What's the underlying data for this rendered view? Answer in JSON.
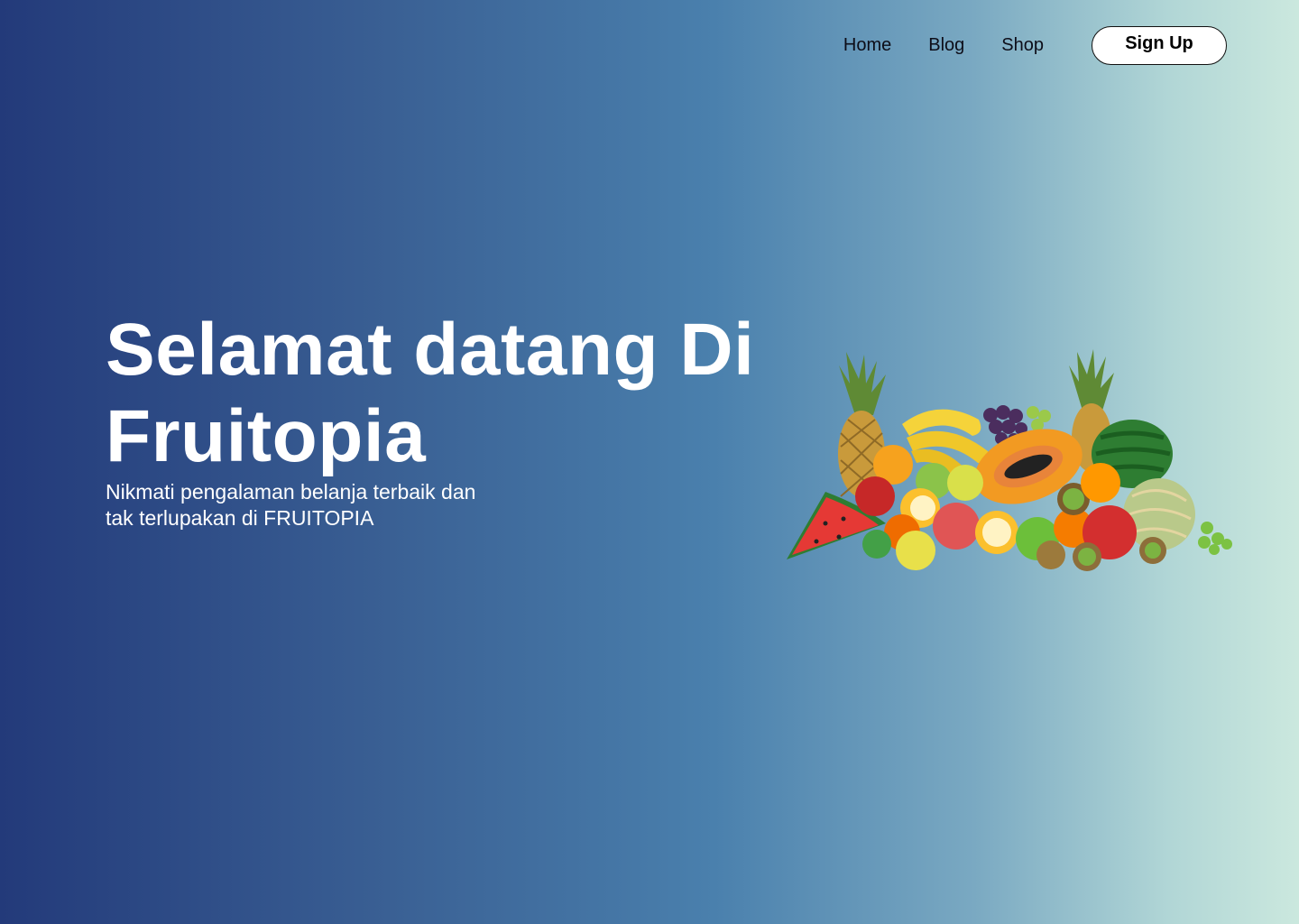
{
  "nav": {
    "links": [
      "Home",
      "Blog",
      "Shop"
    ],
    "signup_label": "Sign Up"
  },
  "hero": {
    "title_line1": "Selamat datang Di",
    "title_line2": "Fruitopia",
    "subtitle_line1": "Nikmati pengalaman belanja terbaik dan",
    "subtitle_line2": "tak terlupakan di FRUITOPIA"
  },
  "colors": {
    "gradient_start": "#233a7a",
    "gradient_end": "#cbe8de",
    "text_light": "#ffffff",
    "nav_text": "#0d0d18",
    "button_bg": "#ffffff"
  },
  "illustration": {
    "icon": "fruit-basket-icon"
  }
}
